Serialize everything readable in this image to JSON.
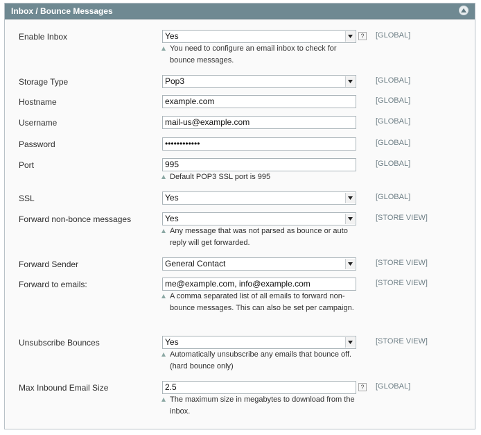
{
  "panel": {
    "title": "Inbox / Bounce Messages"
  },
  "fields": {
    "enable_inbox": {
      "label": "Enable Inbox",
      "value": "Yes",
      "scope": "[GLOBAL]",
      "note": "You need to configure an email inbox to check for bounce messages.",
      "help": "?"
    },
    "storage_type": {
      "label": "Storage Type",
      "value": "Pop3",
      "scope": "[GLOBAL]"
    },
    "hostname": {
      "label": "Hostname",
      "value": "example.com",
      "scope": "[GLOBAL]"
    },
    "username": {
      "label": "Username",
      "value": "mail-us@example.com",
      "scope": "[GLOBAL]"
    },
    "password": {
      "label": "Password",
      "value": "••••••••••••",
      "scope": "[GLOBAL]"
    },
    "port": {
      "label": "Port",
      "value": "995",
      "scope": "[GLOBAL]",
      "note": "Default POP3 SSL port is 995"
    },
    "ssl": {
      "label": "SSL",
      "value": "Yes",
      "scope": "[GLOBAL]"
    },
    "forward_non_bounce": {
      "label": "Forward non-bonce messages",
      "value": "Yes",
      "scope": "[STORE VIEW]",
      "note": "Any message that was not parsed as bounce or auto reply will get forwarded."
    },
    "forward_sender": {
      "label": "Forward Sender",
      "value": "General Contact",
      "scope": "[STORE VIEW]"
    },
    "forward_to_emails": {
      "label": "Forward to emails:",
      "value": "me@example.com, info@example.com",
      "scope": "[STORE VIEW]",
      "note": "A comma separated list of all emails to forward non-bounce messages. This can also be set per campaign."
    },
    "unsubscribe_bounces": {
      "label": "Unsubscribe Bounces",
      "value": "Yes",
      "scope": "[STORE VIEW]",
      "note": "Automatically unsubscribe any emails that bounce off. (hard bounce only)"
    },
    "max_inbound_size": {
      "label": "Max Inbound Email Size",
      "value": "2.5",
      "scope": "[GLOBAL]",
      "note": "The maximum size in megabytes to download from the inbox.",
      "help": "?"
    }
  },
  "icons": {
    "collapse": "collapse-up-icon",
    "dropdown": "chevron-down-icon",
    "help": "help-icon",
    "note": "note-triangle-icon"
  },
  "colors": {
    "header": "#6f8992",
    "scope": "#6e7f86",
    "note_marker": "#8ca8a4"
  }
}
